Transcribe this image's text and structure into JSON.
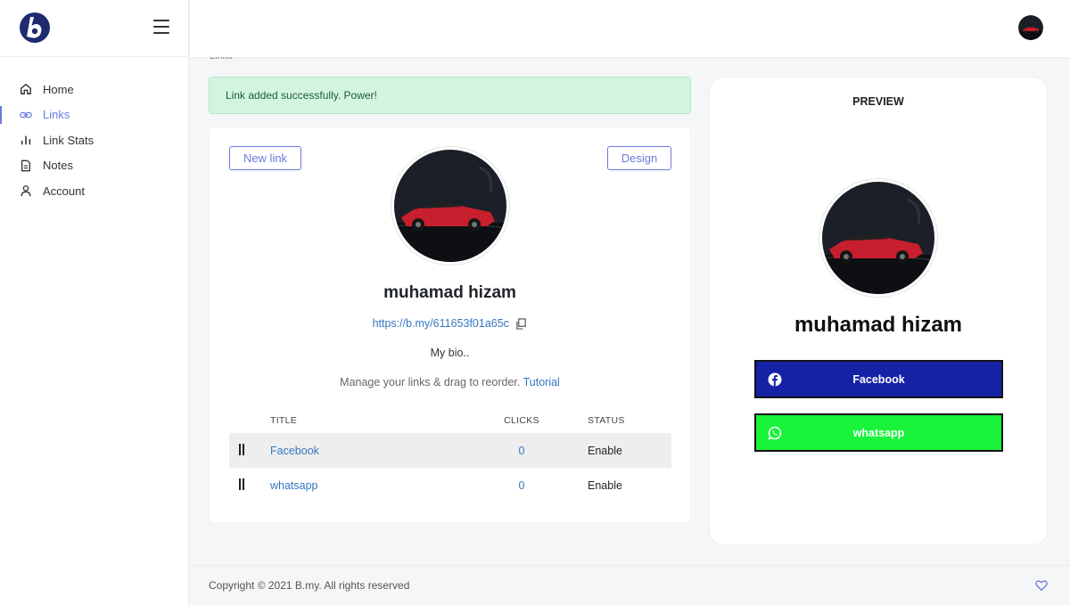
{
  "sidebar": {
    "items": [
      {
        "label": "Home",
        "icon": "home-icon"
      },
      {
        "label": "Links",
        "icon": "link-icon",
        "active": true
      },
      {
        "label": "Link Stats",
        "icon": "bar-chart-icon"
      },
      {
        "label": "Notes",
        "icon": "document-icon"
      },
      {
        "label": "Account",
        "icon": "user-icon"
      }
    ]
  },
  "breadcrumb": "Links",
  "alert": {
    "text": "Link added successfully. Power!"
  },
  "buttons": {
    "new_link": "New link",
    "design": "Design"
  },
  "profile": {
    "name": "muhamad hizam",
    "url": "https://b.my/611653f01a65c",
    "bio": "My bio.."
  },
  "manage": {
    "text": "Manage your links & drag to reorder.",
    "tutorial": "Tutorial"
  },
  "table": {
    "headers": {
      "title": "TITLE",
      "clicks": "CLICKS",
      "status": "STATUS"
    },
    "rows": [
      {
        "title": "Facebook",
        "clicks": "0",
        "status": "Enable"
      },
      {
        "title": "whatsapp",
        "clicks": "0",
        "status": "Enable"
      }
    ]
  },
  "preview": {
    "title": "PREVIEW",
    "name": "muhamad hizam",
    "links": [
      {
        "label": "Facebook",
        "icon": "facebook-icon",
        "color": "#1522a6"
      },
      {
        "label": "whatsapp",
        "icon": "whatsapp-icon",
        "color": "#19f43a"
      }
    ]
  },
  "footer": {
    "copyright": "Copyright © 2021 B.my. All rights reserved"
  },
  "colors": {
    "accent": "#6c7ae0",
    "link": "#3577c2",
    "alert_bg": "#d4f4e2"
  }
}
